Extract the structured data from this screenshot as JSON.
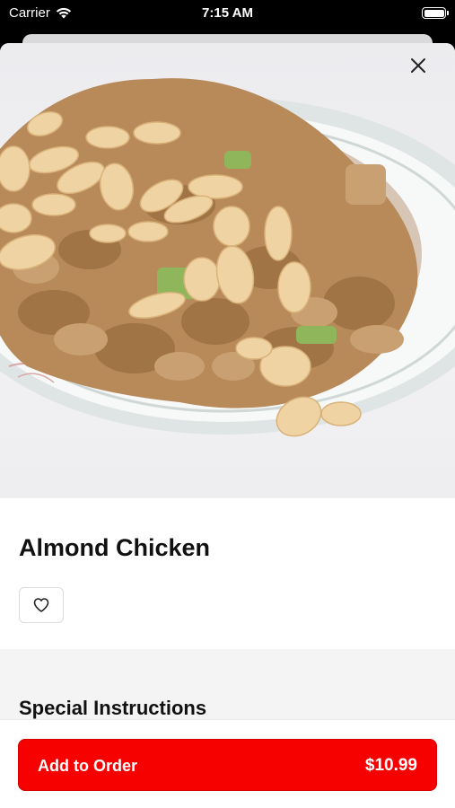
{
  "status_bar": {
    "carrier": "Carrier",
    "time": "7:15 AM"
  },
  "item": {
    "name": "Almond Chicken",
    "image_icon": "food-photo"
  },
  "special_instructions": {
    "title": "Special Instructions"
  },
  "footer": {
    "add_label": "Add to Order",
    "price": "$10.99"
  },
  "colors": {
    "accent": "#f60000",
    "background": "#ffffff",
    "section_bg": "#f4f4f5"
  }
}
